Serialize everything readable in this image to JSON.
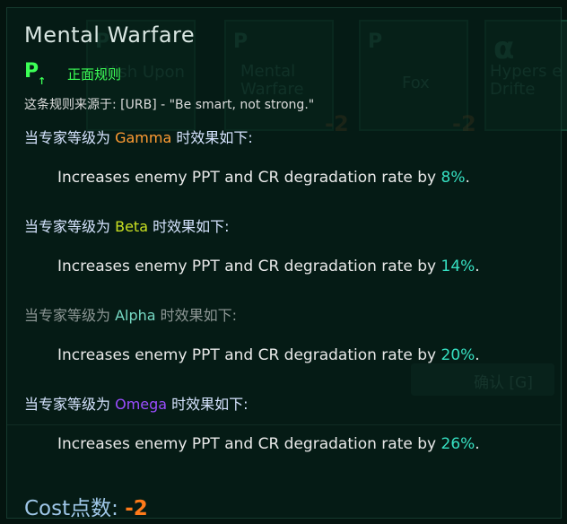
{
  "background": {
    "cards": [
      {
        "p": "P",
        "name": "Wish Upon",
        "cost": ""
      },
      {
        "p": "P",
        "name": "Mental Warfare",
        "cost": "-2"
      },
      {
        "p": "P",
        "name": "Fox",
        "cost": "-2"
      },
      {
        "p": "α",
        "name": "Hypers e Drifte",
        "cost": ""
      }
    ],
    "confirm_label": "确认 [G]"
  },
  "tooltip": {
    "title": "Mental Warfare",
    "rule_icon": "P",
    "rule_type": "正面规则",
    "source": "这条规则来源于: [URB] - \"Be smart, not strong.\"",
    "levels": [
      {
        "prefix": "当专家等级为 ",
        "grade": "Gamma",
        "suffix": " 时效果如下:",
        "desc": "Increases enemy PPT and CR degradation rate by ",
        "pct": "8%",
        "end": "."
      },
      {
        "prefix": "当专家等级为 ",
        "grade": "Beta",
        "suffix": " 时效果如下:",
        "desc": "Increases enemy PPT and CR degradation rate by ",
        "pct": "14%",
        "end": "."
      },
      {
        "prefix": "当专家等级为 ",
        "grade": "Alpha",
        "suffix": " 时效果如下:",
        "desc": "Increases enemy PPT and CR degradation rate by ",
        "pct": "20%",
        "end": "."
      },
      {
        "prefix": "当专家等级为 ",
        "grade": "Omega",
        "suffix": " 时效果如下:",
        "desc": "Increases enemy PPT and CR degradation rate by ",
        "pct": "26%",
        "end": "."
      }
    ],
    "cost_label": "Cost点数: ",
    "cost_value": "-2"
  },
  "colors": {
    "gamma": "#ff9c33",
    "beta": "#c9e022",
    "alpha": "#76d9c4",
    "omega": "#9b4dff",
    "percent": "#36e0c2",
    "positive_rule": "#3cff56",
    "cost_value": "#ff7a1a"
  }
}
